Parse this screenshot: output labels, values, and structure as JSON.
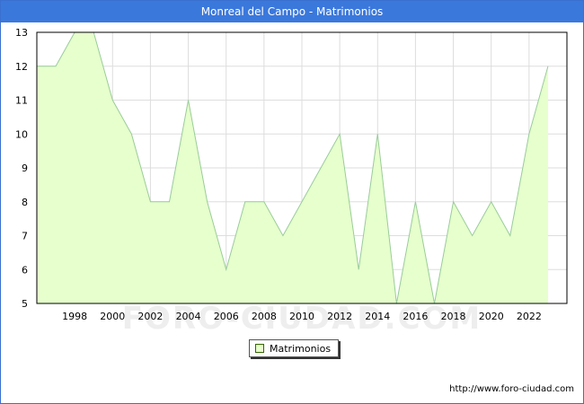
{
  "window": {
    "title": "Monreal del Campo - Matrimonios"
  },
  "colors": {
    "title_bar": "#3b78dc",
    "area_fill": "#e6ffcc",
    "line": "#99cc99",
    "grid": "#dddddd",
    "watermark": "#eeeeee"
  },
  "watermark": "FORO-CIUDAD.COM",
  "legend": {
    "label": "Matrimonios"
  },
  "footer": {
    "url": "http://www.foro-ciudad.com"
  },
  "chart_data": {
    "type": "area",
    "title": "Monreal del Campo - Matrimonios",
    "xlim": [
      1996,
      2024
    ],
    "ylim": [
      5,
      13
    ],
    "x_ticks": [
      1998,
      2000,
      2002,
      2004,
      2006,
      2008,
      2010,
      2012,
      2014,
      2016,
      2018,
      2020,
      2022
    ],
    "y_ticks": [
      5,
      6,
      7,
      8,
      9,
      10,
      11,
      12,
      13
    ],
    "grid": true,
    "legend_position": "bottom-center",
    "series": [
      {
        "name": "Matrimonios",
        "x": [
          1996,
          1997,
          1998,
          1999,
          2000,
          2001,
          2002,
          2003,
          2004,
          2005,
          2006,
          2007,
          2008,
          2009,
          2010,
          2011,
          2012,
          2013,
          2014,
          2015,
          2016,
          2017,
          2018,
          2019,
          2020,
          2021,
          2022,
          2023
        ],
        "values": [
          12,
          12,
          13,
          13,
          11,
          10,
          8,
          8,
          11,
          8,
          6,
          8,
          8,
          7,
          8,
          9,
          10,
          6,
          10,
          5,
          8,
          5,
          8,
          7,
          8,
          7,
          10,
          12
        ]
      }
    ]
  }
}
